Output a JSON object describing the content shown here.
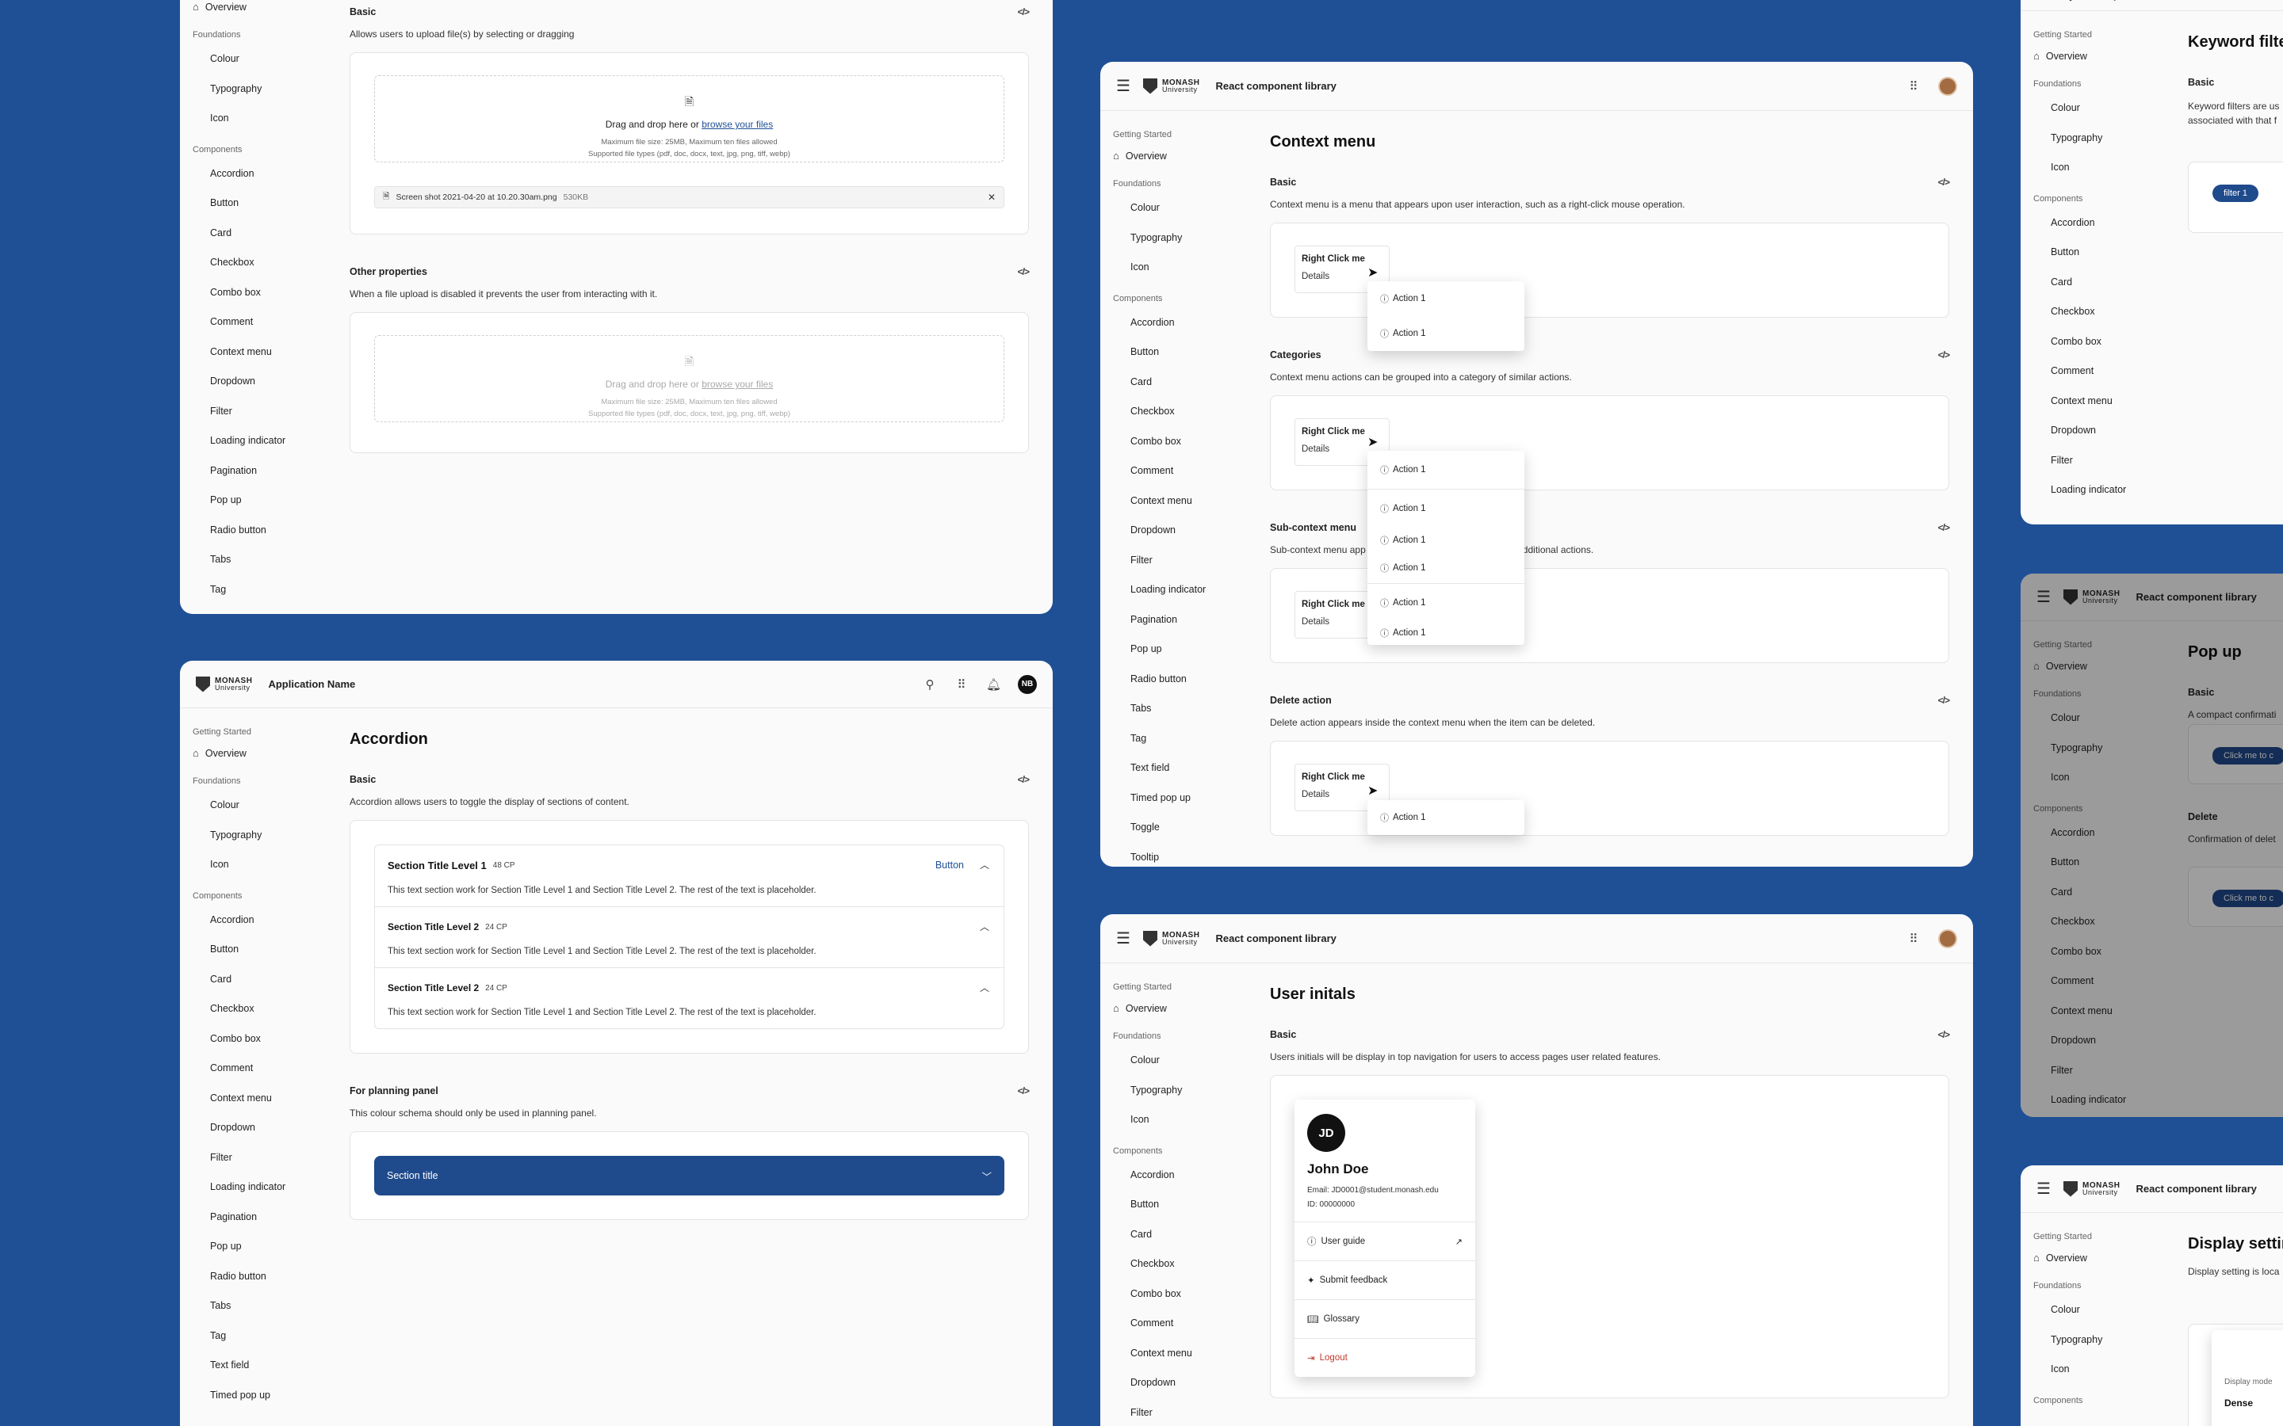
{
  "brand": {
    "logo_line1": "MONASH",
    "logo_line2": "University"
  },
  "sidebar": {
    "getting_started": "Getting Started",
    "overview": "Overview",
    "foundations": "Foundations",
    "foundation_items": [
      "Colour",
      "Typography",
      "Icon"
    ],
    "components": "Components",
    "component_items": [
      "Accordion",
      "Button",
      "Card",
      "Checkbox",
      "Combo box",
      "Comment",
      "Context menu",
      "Dropdown",
      "Filter",
      "Loading indicator",
      "Pagination",
      "Pop up",
      "Radio button",
      "Tabs",
      "Tag",
      "Text field",
      "Timed pop up",
      "Toggle",
      "Tooltip"
    ]
  },
  "fileupload": {
    "basic_title": "Basic",
    "basic_desc": "Allows users to upload file(s) by selecting or dragging",
    "drop_text": "Drag and drop here or",
    "browse": "browse your files",
    "meta1": "Maximum file size: 25MB, Maximum ten files allowed",
    "meta2": "Supported file types (pdf, doc, docx, text, jpg, png, tiff, webp)",
    "file_name": "Screen shot 2021-04-20 at 10.20.30am.png",
    "file_size": "530KB",
    "other_title": "Other properties",
    "other_desc": "When a file upload is disabled it prevents the user from interacting with it."
  },
  "accordion": {
    "app_name": "Application Name",
    "initials": "NB",
    "title": "Accordion",
    "basic_title": "Basic",
    "basic_desc": "Accordion allows users to toggle the display of sections of content.",
    "items": [
      {
        "title": "Section Title Level 1",
        "cp": "48 CP",
        "body": "This text section work for Section Title Level 1 and Section Title Level 2. The rest of the text is placeholder."
      },
      {
        "title": "Section Title Level 2",
        "cp": "24 CP",
        "body": "This text section work for Section Title Level 1 and Section Title Level 2. The rest of the text is placeholder."
      },
      {
        "title": "Section Title Level 2",
        "cp": "24 CP",
        "body": "This text section work for Section Title Level 1 and Section Title Level 2. The rest of the text is placeholder."
      }
    ],
    "item_button": "Button",
    "planning_title": "For planning panel",
    "planning_desc": "This colour schema should only be used in planning panel.",
    "planning_bar": "Section title"
  },
  "lib_name": "React component library",
  "context": {
    "title": "Context menu",
    "basic_title": "Basic",
    "basic_desc": "Context menu is a menu that appears upon user interaction, such as a right-click mouse operation.",
    "categories_title": "Categories",
    "categories_desc": "Context menu actions can be grouped into a category of similar actions.",
    "sub_title": "Sub-context menu",
    "sub_desc_a": "Sub-context menu app",
    "sub_desc_b": "menu action with additional actions.",
    "delete_title": "Delete action",
    "delete_desc": "Delete action appears inside the context menu when the item can be deleted.",
    "right_click": "Right Click me",
    "details": "Details",
    "action": "Action 1"
  },
  "user": {
    "title": "User initals",
    "basic_title": "Basic",
    "basic_desc": "Users initials will be display in top navigation for users to access pages user related features.",
    "initials": "JD",
    "name": "John Doe",
    "email": "Email: JD0001@student.monash.edu",
    "id": "ID: 00000000",
    "menu": [
      "User guide",
      "Submit feedback",
      "Glossary",
      "Logout"
    ]
  },
  "filter": {
    "title": "Keyword filter",
    "basic_title": "Basic",
    "desc1": "Keyword filters are us",
    "desc2": "associated with that f",
    "chip": "filter 1"
  },
  "popup": {
    "title": "Pop up",
    "basic_title": "Basic",
    "desc": "A compact confirmati",
    "btn": "Click me to c",
    "delete_title": "Delete",
    "delete_desc": "Confirmation of delet",
    "btn2": "Click me to c"
  },
  "display": {
    "title": "Display settin",
    "desc": "Display setting is loca",
    "panel_letter": "D",
    "mode_label": "Display mode",
    "mode_value": "Dense"
  },
  "colors": {
    "background": "#1f5096",
    "accent": "#1f4a8c",
    "logout": "#c0392b"
  }
}
